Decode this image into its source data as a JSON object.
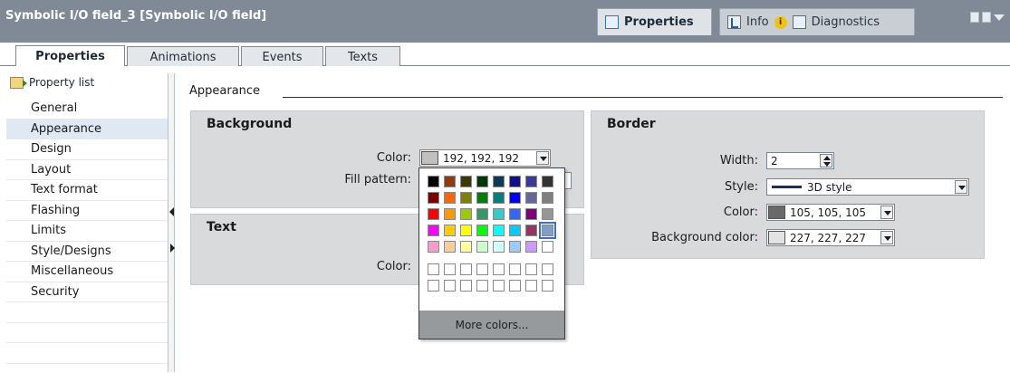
{
  "window": {
    "title": "Symbolic I/O field_3 [Symbolic I/O field]",
    "inspector_tabs": [
      {
        "label": "Properties",
        "active": true,
        "icon": "properties-icon"
      },
      {
        "label": "Info",
        "active": false,
        "icon": "info-icon",
        "badge": "i"
      },
      {
        "label": "Diagnostics",
        "active": false,
        "icon": "diagnostics-icon"
      }
    ]
  },
  "tabs": [
    {
      "label": "Properties",
      "active": true
    },
    {
      "label": "Animations",
      "active": false
    },
    {
      "label": "Events",
      "active": false
    },
    {
      "label": "Texts",
      "active": false
    }
  ],
  "sidebar": {
    "header": "Property list",
    "items": [
      {
        "label": "General",
        "selected": false
      },
      {
        "label": "Appearance",
        "selected": true
      },
      {
        "label": "Design",
        "selected": false
      },
      {
        "label": "Layout",
        "selected": false
      },
      {
        "label": "Text format",
        "selected": false
      },
      {
        "label": "Flashing",
        "selected": false
      },
      {
        "label": "Limits",
        "selected": false
      },
      {
        "label": "Style/Designs",
        "selected": false
      },
      {
        "label": "Miscellaneous",
        "selected": false
      },
      {
        "label": "Security",
        "selected": false
      }
    ]
  },
  "section": {
    "title": "Appearance"
  },
  "background_group": {
    "title": "Background",
    "color_label": "Color:",
    "color_value": "192, 192, 192",
    "color_hex": "#c0c0c0",
    "fill_pattern_label": "Fill pattern:"
  },
  "text_group": {
    "title": "Text",
    "color_label": "Color:"
  },
  "border_group": {
    "title": "Border",
    "width_label": "Width:",
    "width_value": "2",
    "style_label": "Style:",
    "style_value": "3D style",
    "color_label": "Color:",
    "color_value": "105, 105, 105",
    "color_hex": "#696969",
    "bg_color_label": "Background color:",
    "bg_color_value": "227, 227, 227",
    "bg_color_hex": "#e3e3e3"
  },
  "color_picker": {
    "more_colors_label": "More colors...",
    "selected_color": "#7f9fc7",
    "rows": [
      [
        "#000000",
        "#943a0b",
        "#3b3b00",
        "#003b00",
        "#0b3b5c",
        "#10108c",
        "#3a3a9a",
        "#333333"
      ],
      [
        "#800000",
        "#ff6600",
        "#808000",
        "#008000",
        "#008080",
        "#0000ff",
        "#666699",
        "#808080"
      ],
      [
        "#ff0000",
        "#ff9900",
        "#99cc00",
        "#339966",
        "#33cccc",
        "#3366ff",
        "#800080",
        "#969696"
      ],
      [
        "#ff00ff",
        "#ffcc00",
        "#ffff00",
        "#00ff00",
        "#00ffff",
        "#00ccff",
        "#993366",
        "#7f9fc7"
      ],
      [
        "#ff99cc",
        "#ffcc99",
        "#ffff99",
        "#ccffcc",
        "#ccffff",
        "#99ccff",
        "#cc99ff",
        "#ffffff"
      ],
      [
        "#ffffff",
        "#ffffff",
        "#ffffff",
        "#ffffff",
        "#ffffff",
        "#ffffff",
        "#ffffff",
        "#ffffff"
      ],
      [
        "#ffffff",
        "#ffffff",
        "#ffffff",
        "#ffffff",
        "#ffffff",
        "#ffffff",
        "#ffffff",
        "#ffffff"
      ]
    ]
  }
}
